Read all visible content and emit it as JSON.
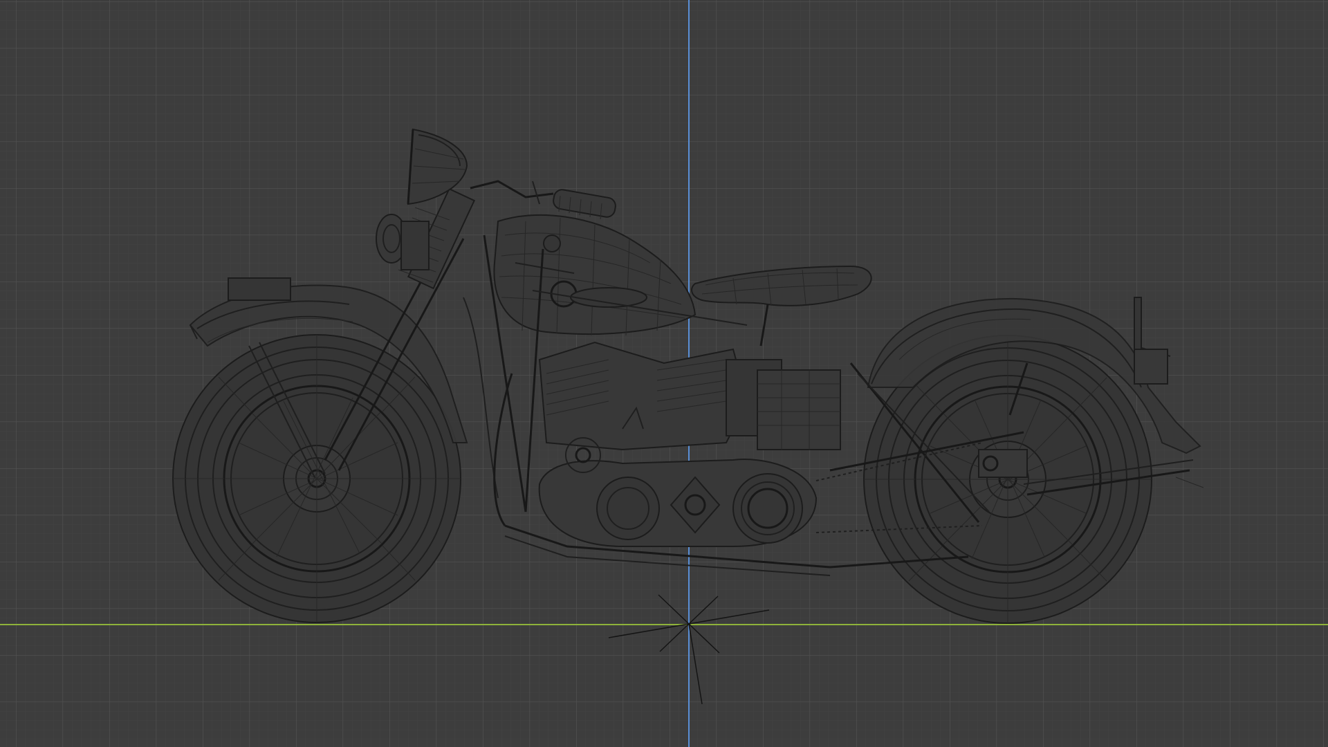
{
  "viewport": {
    "mode": "wireframe",
    "view": "side-orthographic",
    "background_color": "#3d3d3d",
    "grid_minor_color": "#444444",
    "grid_major_color": "#505050",
    "axis_y_color": "#5a8fd6",
    "axis_x_color": "#8fb33a",
    "wire_color": "#1f1f1f",
    "object": {
      "name": "motorcycle-wireframe",
      "parts": [
        "front-wheel",
        "rear-wheel",
        "headlight",
        "handlebar",
        "fuel-tank",
        "seat",
        "engine",
        "front-fender",
        "rear-fender",
        "frame",
        "exhaust",
        "primary-cover",
        "license-plate-bracket"
      ]
    },
    "cursor_3d": {
      "icon": "origin-star-icon"
    }
  }
}
